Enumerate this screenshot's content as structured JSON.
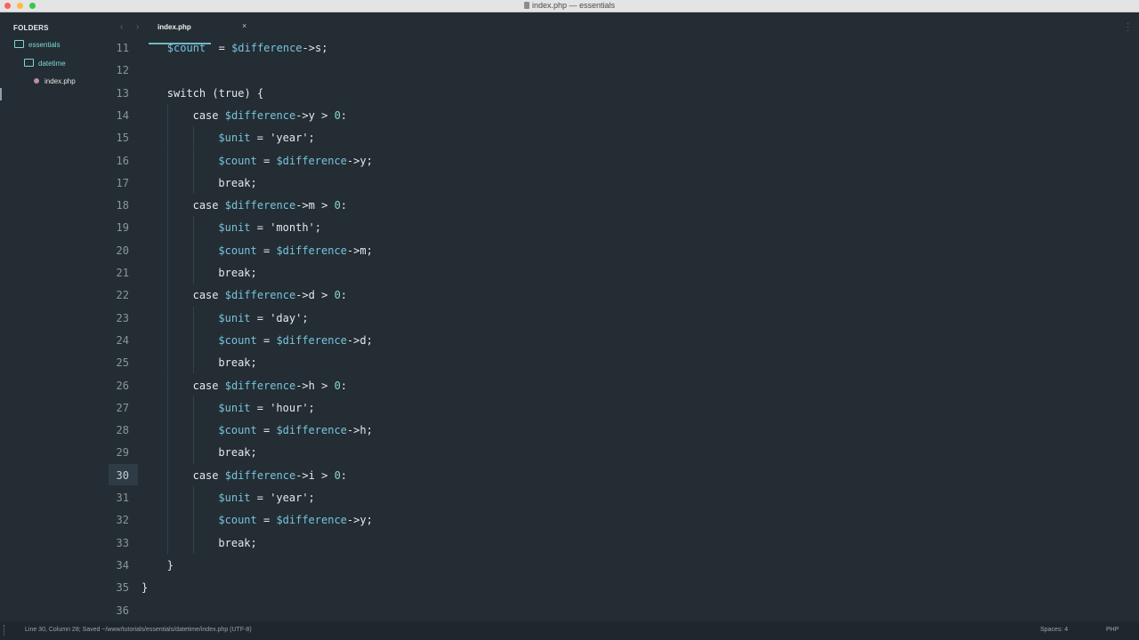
{
  "window": {
    "title": "index.php — essentials"
  },
  "sidebar": {
    "header": "FOLDERS",
    "items": [
      {
        "label": "essentials",
        "type": "folder"
      },
      {
        "label": "datetime",
        "type": "folder"
      },
      {
        "label": "index.php",
        "type": "file"
      }
    ]
  },
  "tabs": [
    {
      "label": "index.php",
      "close": "×"
    }
  ],
  "editor": {
    "current_line": "30",
    "lines": [
      {
        "n": "11",
        "indent": 1,
        "tokens": [
          [
            "var",
            "$count"
          ],
          [
            "",
            "  = "
          ],
          [
            "var",
            "$difference"
          ],
          [
            "",
            "->s;"
          ]
        ]
      },
      {
        "n": "12",
        "indent": 0,
        "tokens": []
      },
      {
        "n": "13",
        "indent": 1,
        "tokens": [
          [
            "",
            "switch (true) {"
          ]
        ]
      },
      {
        "n": "14",
        "indent": 2,
        "tokens": [
          [
            "",
            "case "
          ],
          [
            "var",
            "$difference"
          ],
          [
            "",
            "->y > "
          ],
          [
            "num",
            "0"
          ],
          [
            "",
            ":"
          ]
        ]
      },
      {
        "n": "15",
        "indent": 3,
        "tokens": [
          [
            "var",
            "$unit"
          ],
          [
            "",
            " = 'year';"
          ]
        ]
      },
      {
        "n": "16",
        "indent": 3,
        "tokens": [
          [
            "var",
            "$count"
          ],
          [
            "",
            " = "
          ],
          [
            "var",
            "$difference"
          ],
          [
            "",
            "->y;"
          ]
        ]
      },
      {
        "n": "17",
        "indent": 3,
        "tokens": [
          [
            "",
            "break;"
          ]
        ]
      },
      {
        "n": "18",
        "indent": 2,
        "tokens": [
          [
            "",
            "case "
          ],
          [
            "var",
            "$difference"
          ],
          [
            "",
            "->m > "
          ],
          [
            "num",
            "0"
          ],
          [
            "",
            ":"
          ]
        ]
      },
      {
        "n": "19",
        "indent": 3,
        "tokens": [
          [
            "var",
            "$unit"
          ],
          [
            "",
            " = 'month';"
          ]
        ]
      },
      {
        "n": "20",
        "indent": 3,
        "tokens": [
          [
            "var",
            "$count"
          ],
          [
            "",
            " = "
          ],
          [
            "var",
            "$difference"
          ],
          [
            "",
            "->m;"
          ]
        ]
      },
      {
        "n": "21",
        "indent": 3,
        "tokens": [
          [
            "",
            "break;"
          ]
        ]
      },
      {
        "n": "22",
        "indent": 2,
        "tokens": [
          [
            "",
            "case "
          ],
          [
            "var",
            "$difference"
          ],
          [
            "",
            "->d > "
          ],
          [
            "num",
            "0"
          ],
          [
            "",
            ":"
          ]
        ]
      },
      {
        "n": "23",
        "indent": 3,
        "tokens": [
          [
            "var",
            "$unit"
          ],
          [
            "",
            " = 'day';"
          ]
        ]
      },
      {
        "n": "24",
        "indent": 3,
        "tokens": [
          [
            "var",
            "$count"
          ],
          [
            "",
            " = "
          ],
          [
            "var",
            "$difference"
          ],
          [
            "",
            "->d;"
          ]
        ]
      },
      {
        "n": "25",
        "indent": 3,
        "tokens": [
          [
            "",
            "break;"
          ]
        ]
      },
      {
        "n": "26",
        "indent": 2,
        "tokens": [
          [
            "",
            "case "
          ],
          [
            "var",
            "$difference"
          ],
          [
            "",
            "->h > "
          ],
          [
            "num",
            "0"
          ],
          [
            "",
            ":"
          ]
        ]
      },
      {
        "n": "27",
        "indent": 3,
        "tokens": [
          [
            "var",
            "$unit"
          ],
          [
            "",
            " = 'hour';"
          ]
        ]
      },
      {
        "n": "28",
        "indent": 3,
        "tokens": [
          [
            "var",
            "$count"
          ],
          [
            "",
            " = "
          ],
          [
            "var",
            "$difference"
          ],
          [
            "",
            "->h;"
          ]
        ]
      },
      {
        "n": "29",
        "indent": 3,
        "tokens": [
          [
            "",
            "break;"
          ]
        ]
      },
      {
        "n": "30",
        "indent": 2,
        "tokens": [
          [
            "",
            "case "
          ],
          [
            "var",
            "$difference"
          ],
          [
            "",
            "->i > "
          ],
          [
            "num",
            "0"
          ],
          [
            "",
            ":"
          ]
        ]
      },
      {
        "n": "31",
        "indent": 3,
        "tokens": [
          [
            "var",
            "$unit"
          ],
          [
            "",
            " = 'year';"
          ]
        ]
      },
      {
        "n": "32",
        "indent": 3,
        "tokens": [
          [
            "var",
            "$count"
          ],
          [
            "",
            " = "
          ],
          [
            "var",
            "$difference"
          ],
          [
            "",
            "->y;"
          ]
        ]
      },
      {
        "n": "33",
        "indent": 3,
        "tokens": [
          [
            "",
            "break;"
          ]
        ]
      },
      {
        "n": "34",
        "indent": 1,
        "tokens": [
          [
            "",
            "}"
          ]
        ]
      },
      {
        "n": "35",
        "indent": 0,
        "tokens": [
          [
            "",
            "}"
          ]
        ]
      },
      {
        "n": "36",
        "indent": 0,
        "tokens": []
      }
    ]
  },
  "status": {
    "left": "Line 30, Column 28; Saved ~/www/tutorials/essentials/datetime/index.php (UTF-8)",
    "spaces": "Spaces: 4",
    "syntax": "PHP"
  },
  "colors": {
    "background": "#232d33",
    "variable": "#79c3dc",
    "number": "#88d9c0",
    "accent": "#6fb8c6"
  }
}
